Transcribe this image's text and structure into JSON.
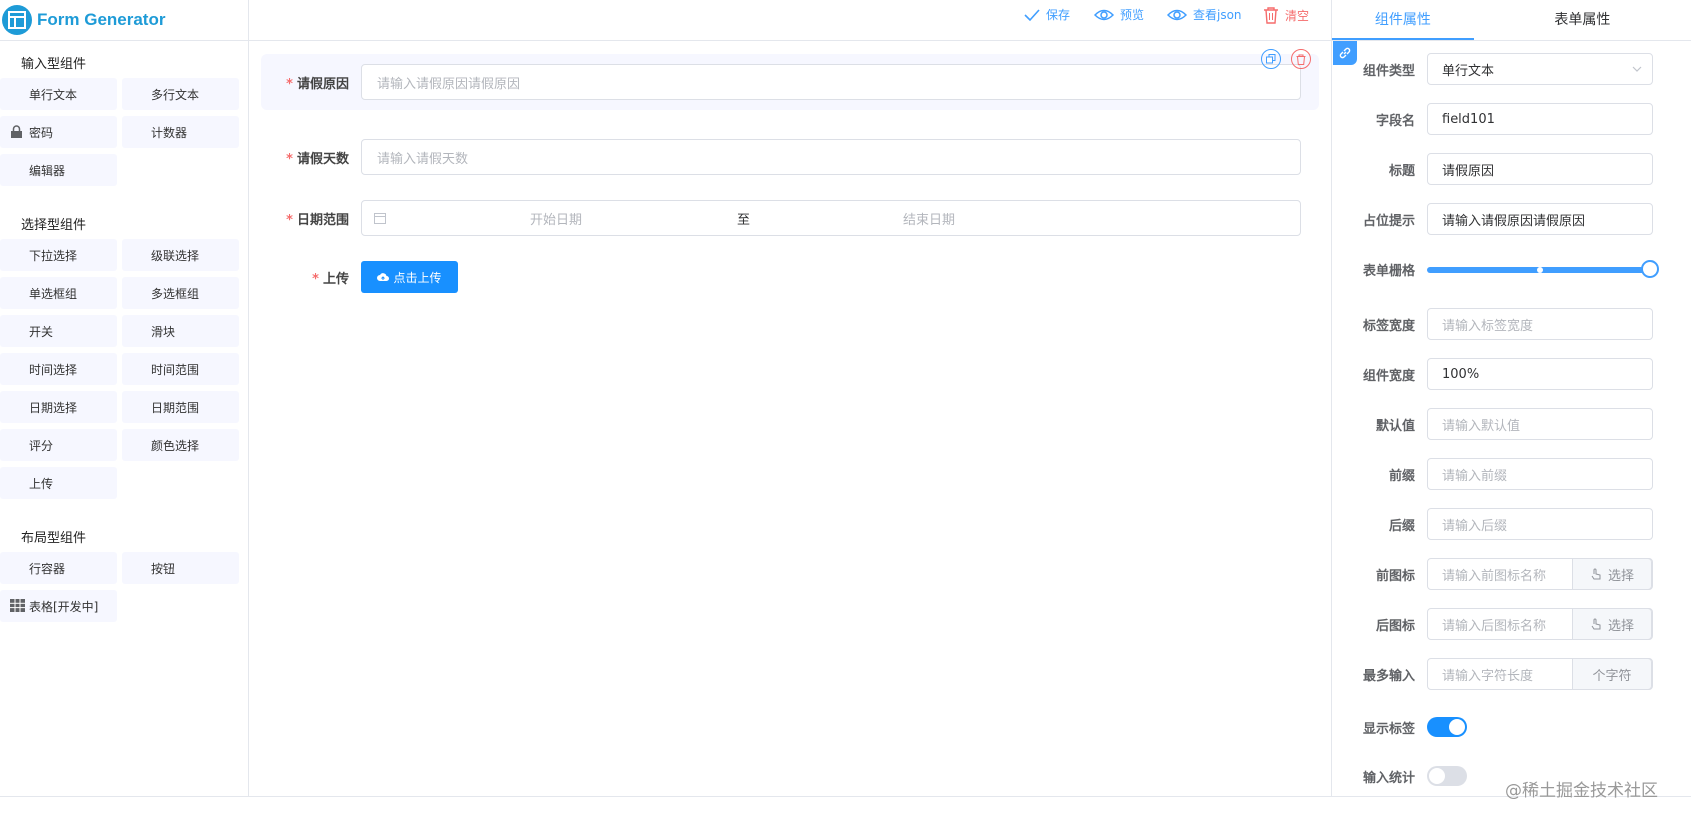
{
  "app": {
    "title": "Form Generator"
  },
  "toolbar": {
    "save": "保存",
    "preview": "预览",
    "view_json": "查看json",
    "clear": "清空"
  },
  "sidebar": {
    "groups": [
      {
        "title": "输入型组件",
        "items": [
          "单行文本",
          "多行文本",
          "密码",
          "计数器",
          "编辑器"
        ]
      },
      {
        "title": "选择型组件",
        "items": [
          "下拉选择",
          "级联选择",
          "单选框组",
          "多选框组",
          "开关",
          "滑块",
          "时间选择",
          "时间范围",
          "日期选择",
          "日期范围",
          "评分",
          "颜色选择",
          "上传"
        ]
      },
      {
        "title": "布局型组件",
        "items": [
          "行容器",
          "按钮",
          "表格[开发中]"
        ]
      }
    ]
  },
  "form": {
    "fields": [
      {
        "label": "请假原因",
        "placeholder": "请输入请假原因请假原因"
      },
      {
        "label": "请假天数",
        "placeholder": "请输入请假天数"
      },
      {
        "label": "日期范围",
        "start": "开始日期",
        "sep": "至",
        "end": "结束日期"
      },
      {
        "label": "上传",
        "button": "点击上传"
      }
    ]
  },
  "panel": {
    "tabs": [
      "组件属性",
      "表单属性"
    ],
    "props": {
      "type": {
        "label": "组件类型",
        "value": "单行文本"
      },
      "field": {
        "label": "字段名",
        "value": "field101"
      },
      "title": {
        "label": "标题",
        "value": "请假原因"
      },
      "placeholder": {
        "label": "占位提示",
        "value": "请输入请假原因请假原因"
      },
      "span": {
        "label": "表单栅格",
        "value": 24,
        "max": 24
      },
      "label_width": {
        "label": "标签宽度",
        "placeholder": "请输入标签宽度"
      },
      "comp_width": {
        "label": "组件宽度",
        "value": "100%"
      },
      "default": {
        "label": "默认值",
        "placeholder": "请输入默认值"
      },
      "prefix": {
        "label": "前缀",
        "placeholder": "请输入前缀"
      },
      "suffix": {
        "label": "后缀",
        "placeholder": "请输入后缀"
      },
      "prefix_icon": {
        "label": "前图标",
        "placeholder": "请输入前图标名称",
        "button": "选择"
      },
      "suffix_icon": {
        "label": "后图标",
        "placeholder": "请输入后图标名称",
        "button": "选择"
      },
      "maxlength": {
        "label": "最多输入",
        "placeholder": "请输入字符长度",
        "append": "个字符"
      },
      "show_label": {
        "label": "显示标签",
        "on": true
      },
      "show_count": {
        "label": "输入统计",
        "on": false
      }
    }
  },
  "watermark": "@稀土掘金技术社区",
  "colors": {
    "primary": "#409eff",
    "brand": "#1e9bd7",
    "danger": "#f56c6c"
  }
}
